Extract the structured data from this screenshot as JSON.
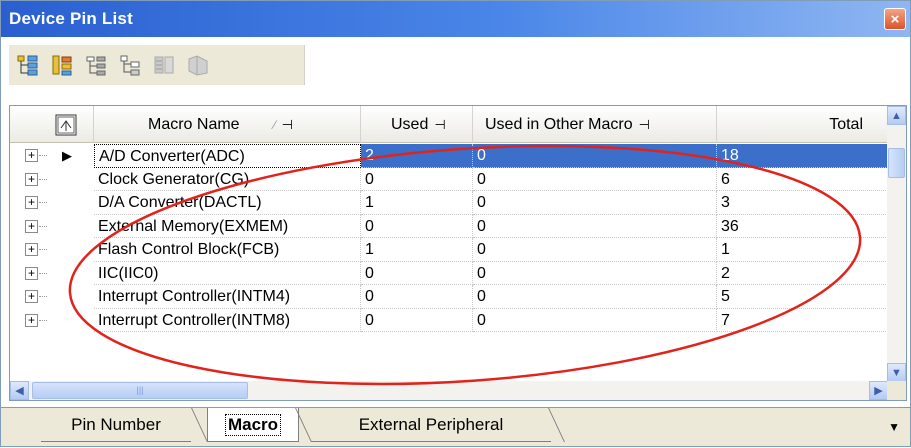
{
  "window": {
    "title": "Device Pin List",
    "close_label": "×"
  },
  "toolbar": {
    "buttons": [
      {
        "name": "expand-all-icon"
      },
      {
        "name": "collapse-all-icon"
      },
      {
        "name": "filter-icon"
      },
      {
        "name": "tree-view-icon"
      },
      {
        "name": "disabled-icon-1"
      },
      {
        "name": "disabled-icon-2"
      }
    ]
  },
  "grid": {
    "columns": {
      "macro_name": "Macro Name",
      "used": "Used",
      "used_in_other": "Used in Other Macro",
      "total": "Total"
    },
    "pin_glyph": "⊣",
    "rows": [
      {
        "name": "A/D Converter(ADC)",
        "used": "2",
        "used_in_other": "0",
        "total": "18"
      },
      {
        "name": "Clock Generator(CG)",
        "used": "0",
        "used_in_other": "0",
        "total": "6"
      },
      {
        "name": "D/A Converter(DACTL)",
        "used": "1",
        "used_in_other": "0",
        "total": "3"
      },
      {
        "name": "External Memory(EXMEM)",
        "used": "0",
        "used_in_other": "0",
        "total": "36"
      },
      {
        "name": "Flash Control Block(FCB)",
        "used": "1",
        "used_in_other": "0",
        "total": "1"
      },
      {
        "name": "IIC(IIC0)",
        "used": "0",
        "used_in_other": "0",
        "total": "2"
      },
      {
        "name": "Interrupt Controller(INTM4)",
        "used": "0",
        "used_in_other": "0",
        "total": "5"
      },
      {
        "name": "Interrupt Controller(INTM8)",
        "used": "0",
        "used_in_other": "0",
        "total": "7"
      }
    ],
    "selected_row": 0
  },
  "tabs": [
    {
      "label": "Pin Number",
      "active": false
    },
    {
      "label": "Macro",
      "active": true
    },
    {
      "label": "External Peripheral",
      "active": false
    }
  ],
  "colors": {
    "selection": "#3c6fc9",
    "title_start": "#2a5fd0",
    "annotation": "#e0241c"
  }
}
